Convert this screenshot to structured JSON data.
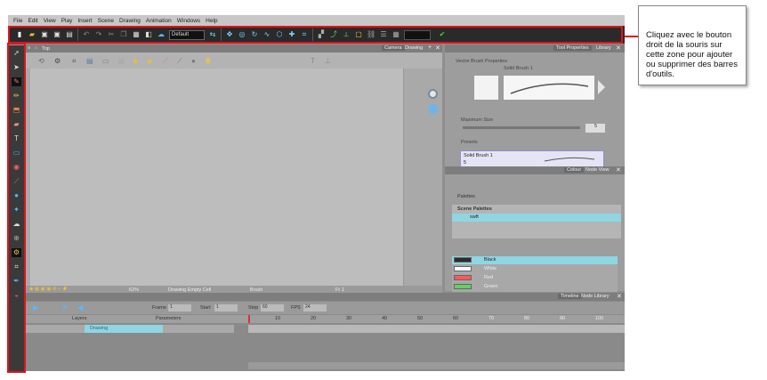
{
  "menu": [
    "File",
    "Edit",
    "View",
    "Play",
    "Insert",
    "Scene",
    "Drawing",
    "Animation",
    "Windows",
    "Help"
  ],
  "toolbar": {
    "preset": "Default"
  },
  "camera_panel": {
    "tabs": [
      "Camera",
      "Drawing"
    ],
    "title": "Top",
    "zoom": "62%",
    "status_drawing": "Drawing Empty Cell",
    "status_tool": "Brush",
    "status_frame": "Fr 1"
  },
  "tool_properties": {
    "tabs": [
      "Tool Properties",
      "Library"
    ],
    "brush_header": "Vector Brush Properties",
    "brush_name": "Solid Brush 1",
    "max_size_label": "Maximum Size",
    "max_size_value": "5",
    "presets_label": "Presets",
    "preset_name": "Solid Brush 1",
    "preset_size": "5"
  },
  "colour_panel": {
    "tabs": [
      "Colour",
      "Node View"
    ],
    "palettes_label": "Palettes",
    "scene_palettes": "Scene Palettes",
    "palette_name": "swft",
    "colours": [
      {
        "name": "Black",
        "swatch": "#2b2b2b"
      },
      {
        "name": "White",
        "swatch": "#ffffff"
      },
      {
        "name": "Red",
        "swatch": "#ff5a5a"
      },
      {
        "name": "Green",
        "swatch": "#5bd65b"
      }
    ]
  },
  "timeline": {
    "tabs": [
      "Timeline",
      "Node Library"
    ],
    "frame_label": "Frame",
    "frame_value": "1",
    "start_label": "Start",
    "start_value": "1",
    "stop_label": "Stop",
    "stop_value": "60",
    "fps_label": "FPS",
    "fps_value": "24",
    "layers_label": "Layers",
    "params_label": "Parameters",
    "layer_name": "Drawing",
    "ruler": [
      "10",
      "20",
      "30",
      "40",
      "50",
      "60",
      "70",
      "80",
      "90",
      "100"
    ]
  },
  "callout": {
    "text": "Cliquez avec le bouton droit de la souris sur cette zone pour ajouter ou supprimer des barres d'outils."
  },
  "colors": {
    "highlight": "#e0141b",
    "selection": "#8fd6e2"
  }
}
